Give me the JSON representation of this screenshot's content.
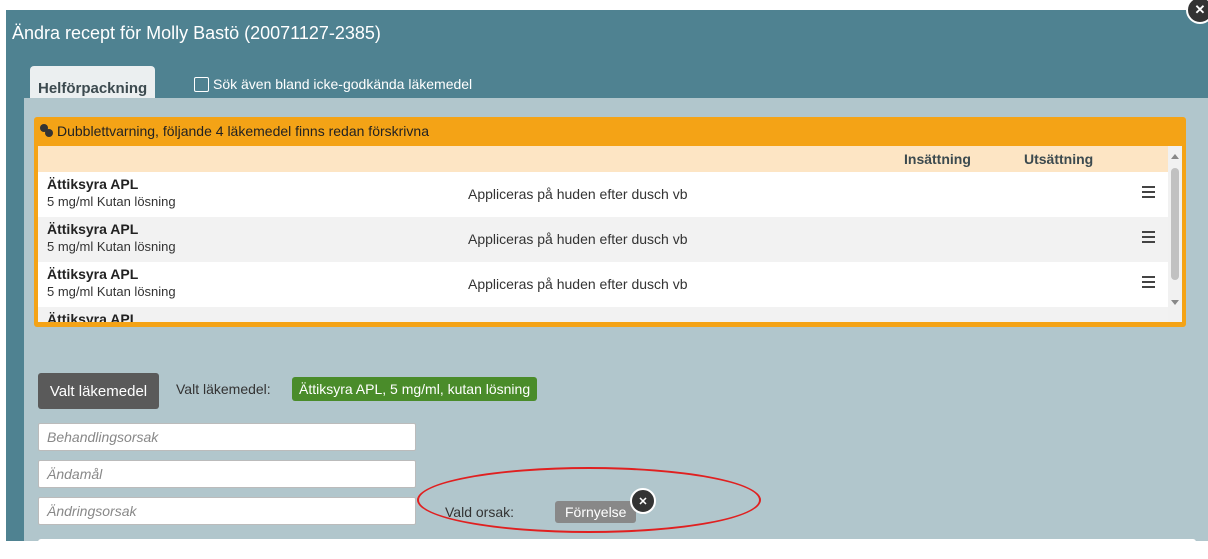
{
  "dialog": {
    "title": "Ändra recept för Molly Bastö (20071127-2385)",
    "close_icon": "close-icon"
  },
  "tabs": {
    "active_tab": "Helförpackning",
    "checkbox_label": "Sök även bland icke-godkända läkemedel",
    "checkbox_checked": false
  },
  "warning": {
    "title": "Dubblettvarning, följande 4 läkemedel finns redan förskrivna",
    "icon": "pills-icon",
    "columns": {
      "insattning": "Insättning",
      "utsattning": "Utsättning"
    },
    "rows": [
      {
        "name": "Ättiksyra APL",
        "strength": "5 mg/ml Kutan lösning",
        "dosage": "Appliceras på huden efter dusch vb"
      },
      {
        "name": "Ättiksyra APL",
        "strength": "5 mg/ml Kutan lösning",
        "dosage": "Appliceras på huden efter dusch vb"
      },
      {
        "name": "Ättiksyra APL",
        "strength": "5 mg/ml Kutan lösning",
        "dosage": "Appliceras på huden efter dusch vb"
      },
      {
        "name": "Ättiksyra APL",
        "strength": "",
        "dosage": ""
      }
    ]
  },
  "selection": {
    "button_label": "Valt läkemedel",
    "label": "Valt läkemedel:",
    "tag_name": "Ättiksyra APL",
    "tag_rest": ", 5 mg/ml, kutan lösning"
  },
  "fields": {
    "behandlingsorsak_placeholder": "Behandlingsorsak",
    "andamal_placeholder": "Ändamål",
    "andringsorsak_placeholder": "Ändringsorsak"
  },
  "reason": {
    "label": "Vald orsak:",
    "chip": "Förnyelse"
  },
  "colors": {
    "dialog_bg": "#4f8291",
    "panel_bg": "#b1c6cc",
    "warning": "#f4a316",
    "selected_tag": "#4a8c2a",
    "highlight": "#e02020"
  }
}
